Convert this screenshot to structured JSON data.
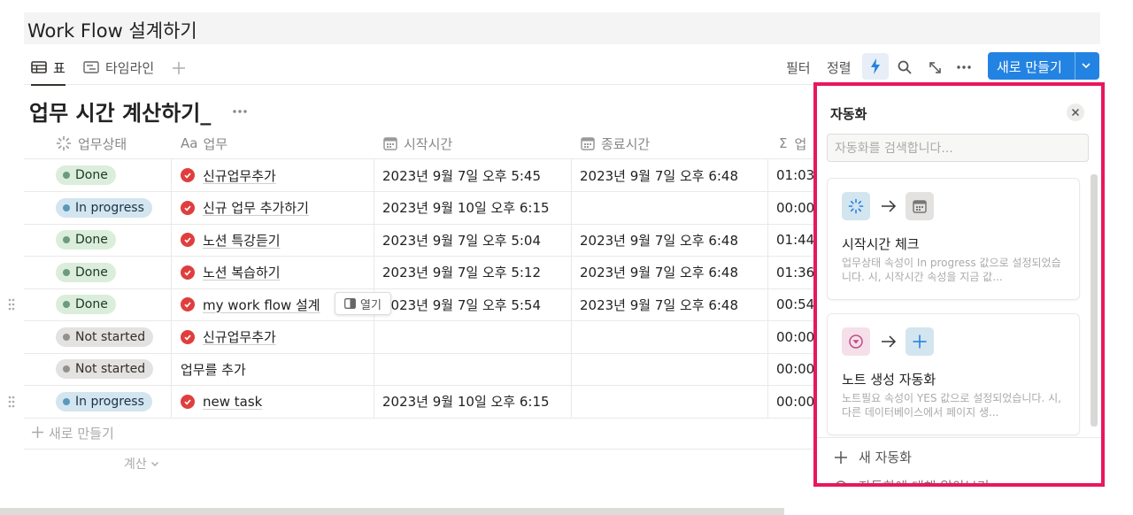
{
  "page_title": "Work Flow 설계하기",
  "views": {
    "table_label": "표",
    "timeline_label": "타임라인"
  },
  "toolbar": {
    "filter": "필터",
    "sort": "정렬",
    "new_button": "새로 만들기"
  },
  "database_title": "업무 시간 계산하기_",
  "columns": {
    "status": "업무상태",
    "task_prefix": "Aa",
    "task": "업무",
    "start": "시작시간",
    "end": "종료시간",
    "sigma": "Σ",
    "duration": "업"
  },
  "rows": [
    {
      "status": "Done",
      "task": "신규업무추가",
      "start": "2023년 9월 7일 오후 5:45",
      "end": "2023년 9월 7일 오후 6:48",
      "duration": "01:03:"
    },
    {
      "status": "In progress",
      "task": "신규 업무 추가하기",
      "start": "2023년 9월 10일 오후 6:15",
      "end": "",
      "duration": "00:00:"
    },
    {
      "status": "Done",
      "task": "노션 특강듣기",
      "start": "2023년 9월 7일 오후 5:04",
      "end": "2023년 9월 7일 오후 6:48",
      "duration": "01:44:"
    },
    {
      "status": "Done",
      "task": "노션 복습하기",
      "start": "2023년 9월 7일 오후 5:12",
      "end": "2023년 9월 7일 오후 6:48",
      "duration": "01:36:"
    },
    {
      "status": "Done",
      "task": "my work flow 설계",
      "start": "2023년 9월 7일 오후 5:54",
      "end": "2023년 9월 7일 오후 6:48",
      "duration": "00:54:"
    },
    {
      "status": "Not started",
      "task": "신규업무추가",
      "start": "",
      "end": "",
      "duration": "00:00:"
    },
    {
      "status": "Not started",
      "task": "업무를 추가",
      "start": "",
      "end": "",
      "duration": "00:00:"
    },
    {
      "status": "In progress",
      "task": "new task",
      "start": "2023년 9월 10일 오후 6:15",
      "end": "",
      "duration": "00:00:"
    }
  ],
  "open_pill": "열기",
  "add_row": "새로 만들기",
  "calc_label": "계산",
  "automation": {
    "title": "자동화",
    "search_placeholder": "자동화를 검색합니다...",
    "cards": [
      {
        "title": "시작시간 체크",
        "desc": "업무상태 속성이 In progress 값으로 설정되었습니다. 시, 시작시간 속성을 지금 값..."
      },
      {
        "title": "노트 생성 자동화",
        "desc": "노트필요 속성이 YES 값으로 설정되었습니다. 시, 다른 데이터베이스에서 페이지 생..."
      }
    ],
    "new_automation": "새 자동화",
    "learn_more": "자동화에 대해 알아보기"
  },
  "colors": {
    "accent": "#2383e2",
    "highlight_border": "#e8175d",
    "done_badge": "#dbeddb",
    "in_progress_badge": "#d3e5ef",
    "not_started_badge": "#e3e2e0",
    "check_red": "#e03e3e"
  }
}
